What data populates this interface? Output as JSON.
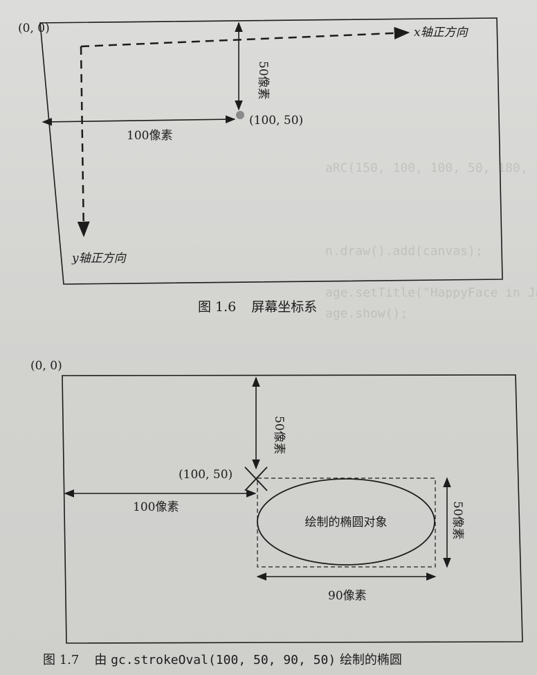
{
  "figure_1_6": {
    "origin_label": "(0, 0)",
    "x_axis_label": "x轴正方向",
    "y_axis_label": "y轴正方向",
    "vertical_distance_label": "50像素",
    "horizontal_distance_label": "100像素",
    "point_label": "(100, 50)",
    "caption_number": "图 1.6",
    "caption_text": "屏幕坐标系"
  },
  "figure_1_7": {
    "origin_label": "(0, 0)",
    "vertical_distance_label": "50像素",
    "corner_label": "(100, 50)",
    "horizontal_distance_label": "100像素",
    "ellipse_label": "绘制的椭圆对象",
    "height_label": "50像素",
    "width_label": "90像素",
    "caption_number": "图 1.7",
    "caption_prefix": "由",
    "caption_code": "gc.strokeOval(100, 50, 90, 50)",
    "caption_suffix": "绘制的椭圆"
  },
  "colors": {
    "ink": "#1c1c1c",
    "point": "#8a8a8a",
    "paper": "#d6d6d4"
  }
}
